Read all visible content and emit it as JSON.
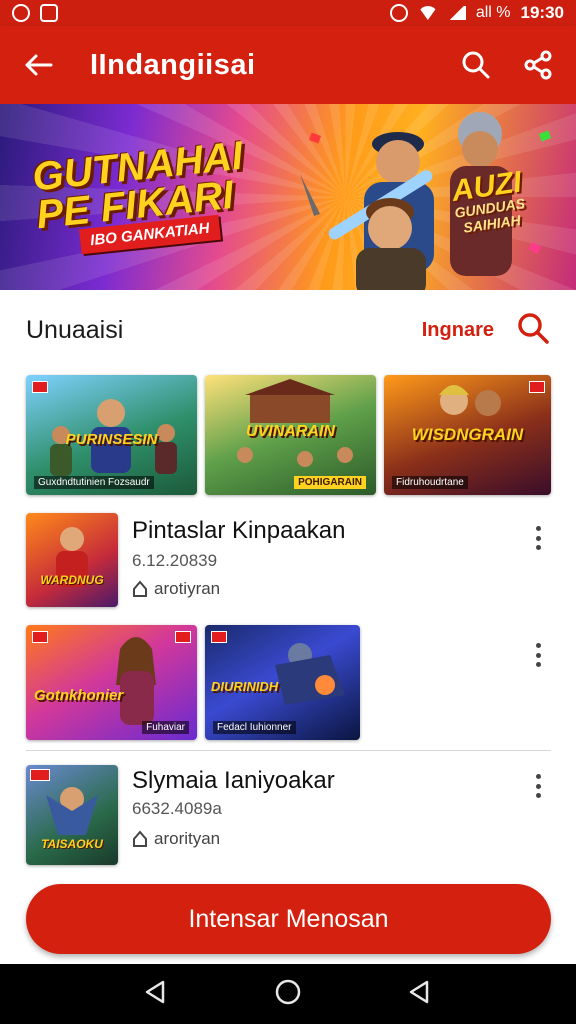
{
  "status_bar": {
    "battery": "all %",
    "time": "19:30"
  },
  "app_bar": {
    "title": "IIndangiisai",
    "back_icon": "arrow-left-icon",
    "search_icon": "search-icon",
    "share_icon": "share-icon"
  },
  "hero": {
    "title": "GUTNAHAI PE FIKARI",
    "subtitle": "IBO GANKATIAH",
    "badge": "AUZI",
    "badge_sub": "GUNDUAS SAIHIAH"
  },
  "section": {
    "title": "Unuaaisi",
    "link": "Ingnare",
    "search_icon": "search-icon"
  },
  "row1": [
    {
      "text": "PURINSESIN",
      "caption": "Guxdndtutinien Fozsaudr"
    },
    {
      "text": "UVINARAIN",
      "caption": "POHIGARAIN"
    },
    {
      "text": "WISDNGRAIN",
      "caption": "Fidruhoudrtane"
    }
  ],
  "item1": {
    "title": "Pintaslar Kinpaakan",
    "meta": "6.12.20839",
    "owner": "arotiyran",
    "thumb_text": "WARDNUG"
  },
  "row2": [
    {
      "text": "Gotnkhonier",
      "caption": "Fuhaviar"
    },
    {
      "text": "DIURINIDH",
      "caption": "Fedacl Iuhionner"
    }
  ],
  "item2": {
    "title": "Slymaia Ianiyoakar",
    "meta": "6632.4089a",
    "owner": "arorityan",
    "thumb_text": "TAISAOKU"
  },
  "cta": {
    "label": "Intensar Menosan"
  },
  "nav": {
    "back_icon": "triangle-back-icon",
    "home_icon": "circle-home-icon",
    "recent_icon": "triangle-recent-icon"
  }
}
